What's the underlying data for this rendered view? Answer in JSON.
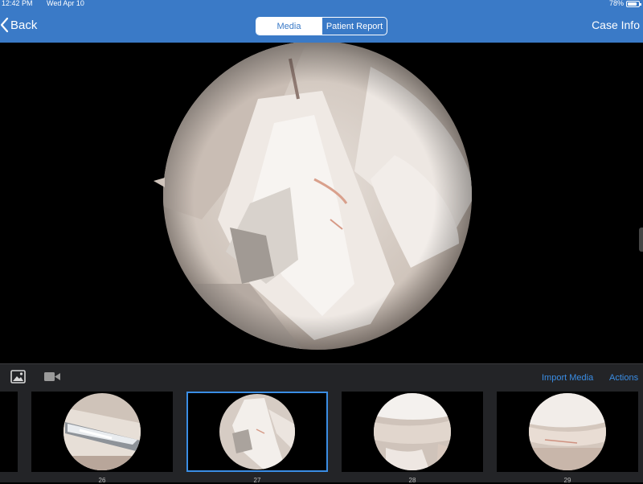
{
  "status": {
    "time": "12:42 PM",
    "date": "Wed Apr 10",
    "battery": "78%"
  },
  "nav": {
    "back_label": "Back",
    "tabs": [
      {
        "label": "Media",
        "selected": true
      },
      {
        "label": "Patient Report",
        "selected": false
      }
    ],
    "case_info_label": "Case Info"
  },
  "toolbar": {
    "photo_icon": "photo-icon",
    "video_icon": "video-camera-icon",
    "import_label": "Import Media",
    "actions_label": "Actions"
  },
  "thumbnails": [
    {
      "label": "",
      "selected": false
    },
    {
      "label": "26",
      "selected": false
    },
    {
      "label": "27",
      "selected": true
    },
    {
      "label": "28",
      "selected": false
    },
    {
      "label": "29",
      "selected": false
    }
  ],
  "colors": {
    "accent": "#3a7ac7",
    "link": "#3a8de4",
    "toolbar_bg": "#232427"
  }
}
